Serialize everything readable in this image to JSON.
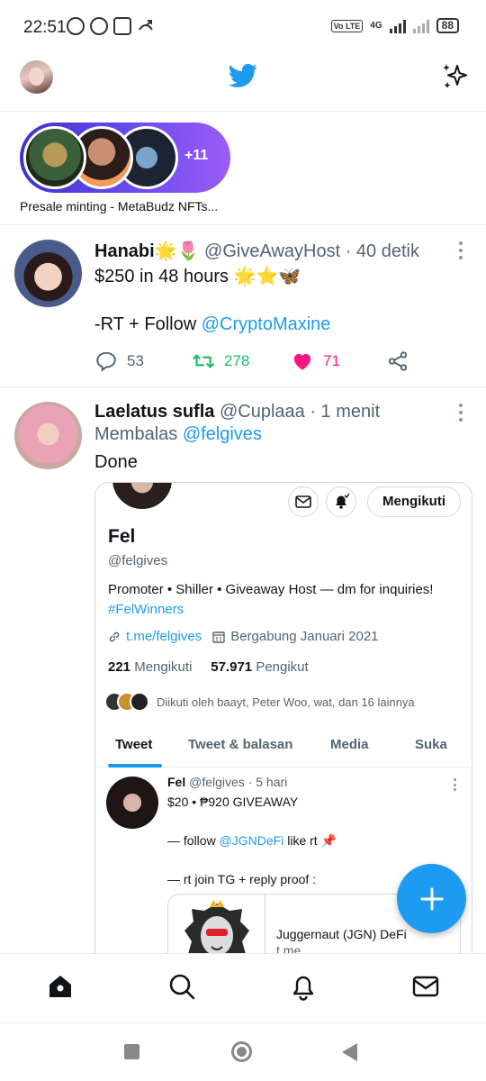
{
  "status_bar": {
    "time": "22:51",
    "battery": "88",
    "network": "4G",
    "volte": "Vo LTE"
  },
  "header": {
    "logo_icon": "twitter-bird-icon",
    "sparkle_icon": "sparkle-icon"
  },
  "fleets": {
    "more_count": "+11",
    "caption": "Presale minting - MetaBudz NFTs..."
  },
  "tweets": [
    {
      "name": "Hanabi🌟🌷",
      "handle": "@GiveAwayHost",
      "time": "· 40 detik",
      "line1": "$250 in 48 hours 🌟⭐🦋",
      "line2_prefix": "-RT + Follow ",
      "line2_link": "@CryptoMaxine",
      "replies": "53",
      "retweets": "278",
      "likes": "71"
    },
    {
      "name": "Laelatus sufla",
      "handle": "@Cuplaaa",
      "time": "· 1 menit",
      "reply_prefix": "Membalas ",
      "reply_to": "@felgives",
      "text": "Done"
    }
  ],
  "profile_card": {
    "follow_label": "Mengikuti",
    "name": "Fel",
    "handle": "@felgives",
    "bio": "Promoter • Shiller • Giveaway Host — dm for inquiries!",
    "bio_hashtag": "#FelWinners",
    "website": "t.me/felgives",
    "joined": "Bergabung Januari 2021",
    "following_count": "221",
    "following_label": "Mengikuti",
    "followers_count": "57.971",
    "followers_label": "Pengikut",
    "known_followers": "Diikuti oleh baayt, Peter Woo, wat, dan 16 lainnya",
    "tabs": [
      "Tweet",
      "Tweet & balasan",
      "Media",
      "Suka"
    ],
    "active_tab": "Tweet",
    "inner_tweet": {
      "name": "Fel",
      "handle": "@felgives",
      "time": "· 5 hari",
      "line1": "$20 • ₱920 GIVEAWAY",
      "line2_prefix": "— follow ",
      "line2_link": "@JGNDeFi",
      "line2_suffix": " like rt 📌",
      "line3": "— rt  join TG + reply proof :",
      "link_card_title": "Juggernaut (JGN) DeFi",
      "link_card_url": "t.me"
    }
  },
  "colors": {
    "accent": "#1d9bf0",
    "retweet": "#17bf63",
    "like": "#f91880",
    "muted": "#536471"
  },
  "bottom_nav": [
    "home-icon",
    "search-icon",
    "notifications-icon",
    "messages-icon"
  ]
}
